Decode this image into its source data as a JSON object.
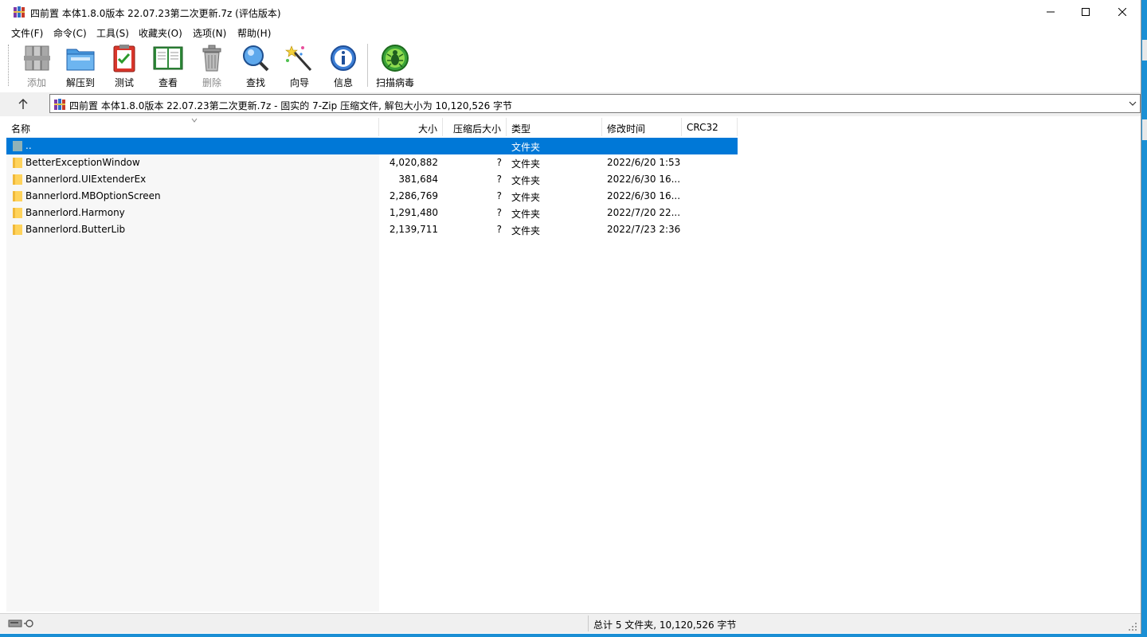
{
  "window": {
    "title": "四前置 本体1.8.0版本 22.07.23第二次更新.7z (评估版本)"
  },
  "menu": [
    "文件(F)",
    "命令(C)",
    "工具(S)",
    "收藏夹(O)",
    "选项(N)",
    "帮助(H)"
  ],
  "toolbar": {
    "add": "添加",
    "extract": "解压到",
    "test": "测试",
    "view": "查看",
    "delete": "删除",
    "find": "查找",
    "wizard": "向导",
    "info": "信息",
    "scan": "扫描病毒"
  },
  "address": {
    "text": "四前置 本体1.8.0版本 22.07.23第二次更新.7z - 固实的 7-Zip 压缩文件, 解包大小为 10,120,526 字节"
  },
  "columns": {
    "name": "名称",
    "size": "大小",
    "packed": "压缩后大小",
    "type": "类型",
    "modified": "修改时间",
    "crc": "CRC32"
  },
  "parent_row": {
    "name": "..",
    "type": "文件夹"
  },
  "files": [
    {
      "name": "BetterExceptionWindow",
      "size": "4,020,882",
      "packed": "?",
      "type": "文件夹",
      "modified": "2022/6/20 1:53"
    },
    {
      "name": "Bannerlord.UIExtenderEx",
      "size": "381,684",
      "packed": "?",
      "type": "文件夹",
      "modified": "2022/6/30 16..."
    },
    {
      "name": "Bannerlord.MBOptionScreen",
      "size": "2,286,769",
      "packed": "?",
      "type": "文件夹",
      "modified": "2022/6/30 16..."
    },
    {
      "name": "Bannerlord.Harmony",
      "size": "1,291,480",
      "packed": "?",
      "type": "文件夹",
      "modified": "2022/7/20 22..."
    },
    {
      "name": "Bannerlord.ButterLib",
      "size": "2,139,711",
      "packed": "?",
      "type": "文件夹",
      "modified": "2022/7/23 2:36"
    }
  ],
  "status": {
    "summary": "总计 5 文件夹, 10,120,526 字节"
  },
  "icons": {
    "app": "winrar-books-icon",
    "selection_color": "#0078d7",
    "folder_color": "#ffd35b"
  }
}
